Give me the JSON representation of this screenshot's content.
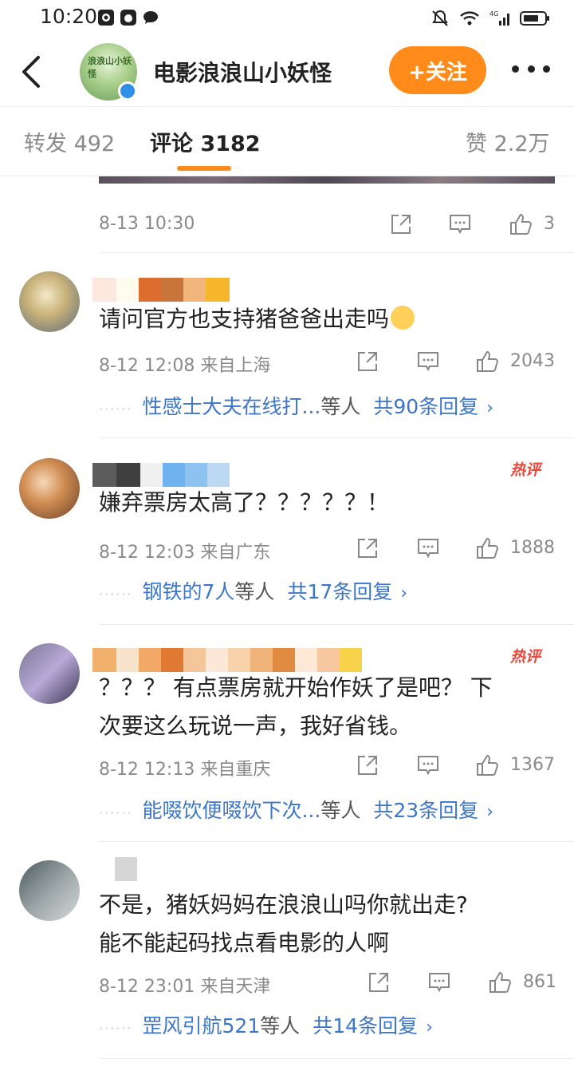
{
  "status_bar": {
    "time": "10:20",
    "network": "4G"
  },
  "header": {
    "account_name": "电影浪浪山小妖怪",
    "follow_label": "+关注",
    "logo_text": "浪浪山小妖怪"
  },
  "tabs": [
    {
      "label": "转发 492"
    },
    {
      "label": "评论 3182"
    },
    {
      "label": "赞 2.2万"
    }
  ],
  "top_meta": {
    "time": "8-13 10:30",
    "likes": "3"
  },
  "comments": [
    {
      "text": "请问官方也支持猪爸爸出走吗",
      "time": "8-12 12:08 来自上海",
      "likes": "2043",
      "reply_who": "性感士大夫在线打...",
      "reply_et": "等人",
      "reply_count": "共90条回复",
      "hot": ""
    },
    {
      "text": "嫌弃票房太高了？？？？？！",
      "time": "8-12 12:03 来自广东",
      "likes": "1888",
      "reply_who": "钢铁的7人",
      "reply_et": "等人",
      "reply_count": "共17条回复",
      "hot": "热评"
    },
    {
      "text": "？？？ 有点票房就开始作妖了是吧？ 下次要这么玩说一声，我好省钱。",
      "line1": "？？？ 有点票房就开始作妖了是吧？ 下",
      "line2": "次要这么玩说一声，我好省钱。",
      "time": "8-12 12:13 来自重庆",
      "likes": "1367",
      "reply_who": "能啜饮便啜饮下次...",
      "reply_et": "等人",
      "reply_count": "共23条回复",
      "hot": "热评"
    },
    {
      "line1": "不是，猪妖妈妈在浪浪山吗你就出走?",
      "line2": "能不能起码找点看电影的人啊",
      "time": "8-12 23:01 来自天津",
      "likes": "861",
      "reply_who": "罡风引航521",
      "reply_et": "等人",
      "reply_count": "共14条回复",
      "hot": ""
    }
  ],
  "colors": {
    "accent": "#ff8c1a",
    "link": "#3c76c8",
    "hot": "#e8473a"
  }
}
